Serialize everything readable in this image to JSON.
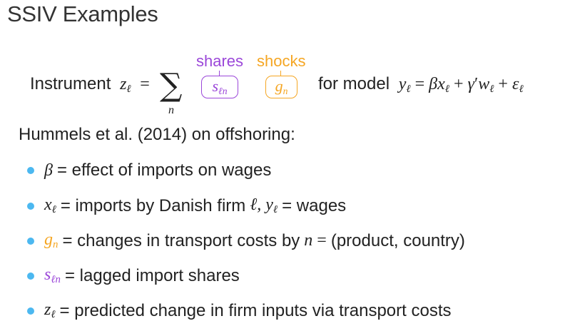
{
  "title": "SSIV Examples",
  "equation": {
    "instrument_label": "Instrument",
    "shares_label": "shares",
    "shocks_label": "shocks",
    "sum_index": "n",
    "model_label": "for model"
  },
  "intro": "Hummels et al. (2014) on offshoring:",
  "bullets": [
    {
      "text": "= effect of imports on wages"
    },
    {
      "text_a": "= imports by Danish firm",
      "text_b": "= wages"
    },
    {
      "text_a": "= changes in transport costs by",
      "text_b": "(product, country)"
    },
    {
      "text": "= lagged import shares"
    },
    {
      "text": "= predicted change in firm inputs via transport costs"
    }
  ],
  "colors": {
    "shares": "#9b47d9",
    "shocks": "#f5a623",
    "bullet": "#4cb8f0"
  }
}
